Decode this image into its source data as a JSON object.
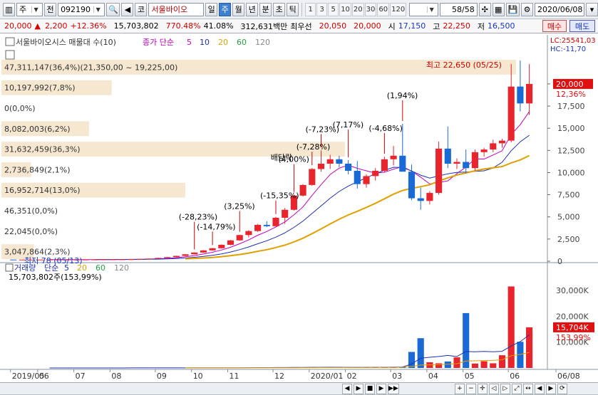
{
  "toolbar": {
    "market": "주",
    "period_btn": "전",
    "code": "092190",
    "name_btn": "코",
    "stock_name": "서울바이오",
    "tf_day": "일",
    "tf_week": "주",
    "tf_month": "월",
    "tf_year": "년",
    "tf_min": "분",
    "tf_sec": "초",
    "tf_tick": "틱",
    "intervals": [
      "1",
      "3",
      "5",
      "10",
      "20",
      "30",
      "60",
      "120"
    ],
    "page": "58",
    "page_total": "/58",
    "date": "2020/06/08"
  },
  "infobar": {
    "price": "20,000",
    "change": "2,200",
    "change_pct": "+12.36%",
    "volume": "15,703,802",
    "vol_ratio": "770.48%",
    "turnover": "41.08%",
    "amount": "312,631백만",
    "label_high": "최우선",
    "bid": "20,050",
    "ask": "20,000",
    "label_open": "시",
    "open": "17,150",
    "label_hi": "고",
    "high": "22,250",
    "label_lo": "저",
    "low": "16,500",
    "buy": "매수",
    "sell": "매도"
  },
  "price_panel": {
    "legend_title": "서울바이오시스 매물대 수(10)",
    "legend_ma": "종가 단순",
    "ma_periods": [
      "5",
      "10",
      "20",
      "60",
      "120"
    ],
    "ma_colors": [
      "#c000c0",
      "#1e2fb0",
      "#e0a000",
      "#22a040",
      "#888888"
    ],
    "lc": "LC:25541,03",
    "hc": "HC:-11,70",
    "current_price": "20,000",
    "current_pct": "12,36%",
    "high_note": "최고 22,650 (05/25)",
    "low_note": "최저 78 (05/13)",
    "dividend": "배당락",
    "y_ticks": [
      "20,000",
      "17,500",
      "15,000",
      "12,500",
      "10,000",
      "7,500",
      "5,000",
      "2,500",
      "0"
    ],
    "volume_profile": [
      {
        "label": "47,311,147(36,4%)(21,350,00 ~ 19,225,00)",
        "share": 36.4
      },
      {
        "label": "10,197,992(7,8%)",
        "share": 7.8
      },
      {
        "label": "0(0,0%)",
        "share": 0
      },
      {
        "label": "8,082,003(6,2%)",
        "share": 6.2
      },
      {
        "label": "31,632,459(36,3%)",
        "share": 24.3
      },
      {
        "label": "2,736,849(2,1%)",
        "share": 2.1
      },
      {
        "label": "16,952,714(13,0%)",
        "share": 13.0
      },
      {
        "label": "46,351(0,0%)",
        "share": 0
      },
      {
        "label": "22,045(0,0%)",
        "share": 0
      },
      {
        "label": "3,047,864(2,3%)",
        "share": 2.3
      }
    ],
    "annotations": [
      "(-7,23%)",
      "(1,94%)",
      "(7,17%)",
      "(-7,28%)",
      "(-4,68%)",
      "(4,00%)",
      "(-15,35%)",
      "(3,25%)",
      "(-28,23%)",
      "(-14,79%)"
    ]
  },
  "volume_panel": {
    "legend_title": "거래량",
    "legend_ma": "단순",
    "ma_periods": [
      "5",
      "20",
      "60",
      "120"
    ],
    "ma_colors": [
      "#1e2fb0",
      "#e0a000",
      "#22a040",
      "#888888"
    ],
    "value_text": "15,703,802주(153,99%)",
    "current": "15,704K",
    "current_pct": "153,99%",
    "y_ticks": [
      "30,000K",
      "20,000K",
      "10,000K"
    ]
  },
  "x_axis": [
    "2019/05",
    "06",
    "07",
    "08",
    "09",
    "10",
    "11",
    "12",
    "2020/01",
    "02",
    "03",
    "04",
    "05",
    "06",
    "06/08"
  ],
  "chart_data": {
    "type": "candlestick",
    "interval": "weekly",
    "candles": [
      [
        180,
        180,
        175,
        178
      ],
      [
        178,
        180,
        176,
        179
      ],
      [
        179,
        181,
        177,
        180
      ],
      [
        180,
        182,
        178,
        181
      ],
      [
        181,
        183,
        179,
        182
      ],
      [
        182,
        185,
        180,
        184
      ],
      [
        184,
        186,
        182,
        185
      ],
      [
        185,
        188,
        183,
        187
      ],
      [
        187,
        190,
        185,
        189
      ],
      [
        189,
        195,
        187,
        193
      ],
      [
        193,
        200,
        190,
        198
      ],
      [
        198,
        205,
        195,
        203
      ],
      [
        203,
        215,
        200,
        212
      ],
      [
        212,
        230,
        210,
        228
      ],
      [
        228,
        260,
        225,
        255
      ],
      [
        255,
        300,
        250,
        295
      ],
      [
        295,
        380,
        290,
        370
      ],
      [
        370,
        480,
        360,
        460
      ],
      [
        460,
        620,
        450,
        600
      ],
      [
        600,
        800,
        580,
        780
      ],
      [
        780,
        1000,
        760,
        980
      ],
      [
        980,
        1250,
        950,
        1220
      ],
      [
        1220,
        1500,
        1180,
        1460
      ],
      [
        1460,
        1900,
        1420,
        1850
      ],
      [
        1850,
        2400,
        1800,
        2350
      ],
      [
        2350,
        3000,
        2300,
        2950
      ],
      [
        2950,
        3500,
        2700,
        3400
      ],
      [
        3400,
        4200,
        3300,
        4100
      ],
      [
        4100,
        4500,
        3850,
        3950
      ],
      [
        3950,
        5000,
        3900,
        4900
      ],
      [
        4900,
        6000,
        4200,
        5800
      ],
      [
        5800,
        7500,
        5700,
        7400
      ],
      [
        7400,
        8700,
        7300,
        8600
      ],
      [
        8600,
        10500,
        8500,
        10400
      ],
      [
        10400,
        12500,
        10100,
        11000
      ],
      [
        11000,
        12000,
        10400,
        11500
      ],
      [
        11500,
        11900,
        10600,
        11000
      ],
      [
        11000,
        11400,
        9800,
        10200
      ],
      [
        10200,
        11300,
        8200,
        8700
      ],
      [
        8700,
        9800,
        8300,
        9600
      ],
      [
        9600,
        10500,
        9100,
        10200
      ],
      [
        10200,
        11800,
        10000,
        11500
      ],
      [
        11500,
        13000,
        10800,
        11900
      ],
      [
        11900,
        15500,
        11300,
        10100
      ],
      [
        10100,
        10900,
        6900,
        7100
      ],
      [
        7100,
        8300,
        5800,
        6800
      ],
      [
        6800,
        7900,
        6400,
        7700
      ],
      [
        7700,
        13500,
        7500,
        12700
      ],
      [
        12700,
        15200,
        10500,
        11000
      ],
      [
        11000,
        11600,
        10400,
        11200
      ],
      [
        11200,
        12600,
        9900,
        10500
      ],
      [
        10500,
        12600,
        10200,
        12300
      ],
      [
        12300,
        12800,
        11800,
        12600
      ],
      [
        12600,
        13700,
        12300,
        13300
      ],
      [
        13300,
        13800,
        12800,
        13600
      ],
      [
        13600,
        22250,
        13400,
        19700
      ],
      [
        19700,
        22650,
        16900,
        17800
      ],
      [
        17800,
        22250,
        16500,
        20000
      ]
    ],
    "volume_k": [
      10,
      12,
      9,
      11,
      8,
      10,
      12,
      9,
      10,
      11,
      13,
      12,
      15,
      18,
      22,
      25,
      30,
      35,
      40,
      50,
      60,
      70,
      80,
      90,
      100,
      120,
      150,
      170,
      160,
      190,
      210,
      240,
      260,
      300,
      280,
      260,
      240,
      220,
      260,
      300,
      320,
      340,
      360,
      420,
      6200,
      11500,
      2200,
      1800,
      2500,
      4100,
      21200,
      1700,
      2600,
      1800,
      4900,
      31500,
      10100,
      15704
    ],
    "ylim_price": [
      0,
      22000
    ],
    "ylim_volume_k": [
      0,
      33000
    ]
  }
}
